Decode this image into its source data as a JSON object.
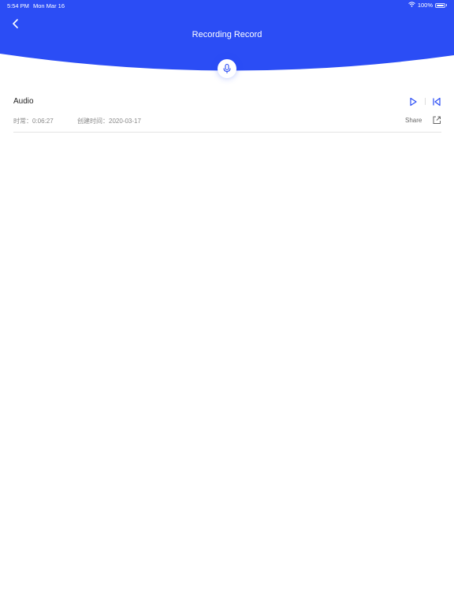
{
  "status_bar": {
    "time": "5:54 PM",
    "date": "Mon Mar 16",
    "battery": "100%",
    "wifi_icon": "wifi-icon",
    "battery_icon": "battery-icon"
  },
  "header": {
    "title": "Recording Record",
    "back_icon": "chevron-left-icon",
    "mic_icon": "microphone-icon"
  },
  "records": [
    {
      "name": "Audio",
      "duration": "时常：0:06:27",
      "created": "创建时间：2020-03-17",
      "share_label": "Share",
      "play_icon": "play-icon",
      "rewind_icon": "rewind-icon",
      "share_icon": "share-icon"
    }
  ],
  "colors": {
    "accent": "#2b4df5",
    "background": "#ffffff",
    "divider": "#e4e4e4"
  }
}
